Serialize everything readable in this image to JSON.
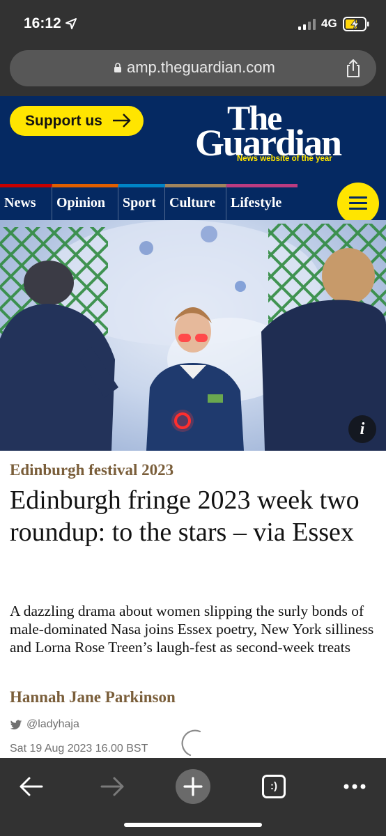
{
  "status_bar": {
    "time": "16:12",
    "network": "4G",
    "icons": [
      "location-arrow-icon",
      "signal-bars-icon",
      "battery-charging-icon"
    ]
  },
  "browser": {
    "url": "amp.theguardian.com",
    "icons": [
      "lock-icon",
      "share-icon"
    ]
  },
  "header": {
    "support_label": "Support us",
    "logo_line1": "The",
    "logo_line2": "Guardian",
    "logo_tagline": "News website of the year"
  },
  "nav": {
    "items": [
      {
        "label": "News",
        "color": "#c70000"
      },
      {
        "label": "Opinion",
        "color": "#e05e00"
      },
      {
        "label": "Sport",
        "color": "#0084c6"
      },
      {
        "label": "Culture",
        "color": "#a1845c"
      },
      {
        "label": "Lifestyle",
        "color": "#bb3b80"
      }
    ]
  },
  "article": {
    "image_info_label": "i",
    "kicker": "Edinburgh festival 2023",
    "headline": "Edinburgh fringe 2023 week two roundup: to the stars – via Essex",
    "standfirst": "A dazzling drama about women slipping the surly bonds of male-dominated Nasa joins Essex poetry, New York silliness and Lorna Rose Treen’s laugh-fest as second-week treats",
    "byline": "Hannah Jane Parkinson",
    "twitter_handle": "@ladyhaja",
    "date": "Sat 19 Aug 2023 16.00 BST"
  },
  "toolbar": {
    "icons": [
      "back-arrow-icon",
      "forward-arrow-icon",
      "new-tab-plus-icon",
      "tabs-icon",
      "more-dots-icon"
    ],
    "tabs_label": ":)"
  },
  "colors": {
    "guardian_blue": "#052962",
    "support_yellow": "#ffe500",
    "kicker_brown": "#7a5e3a",
    "browser_chrome": "#323232"
  }
}
